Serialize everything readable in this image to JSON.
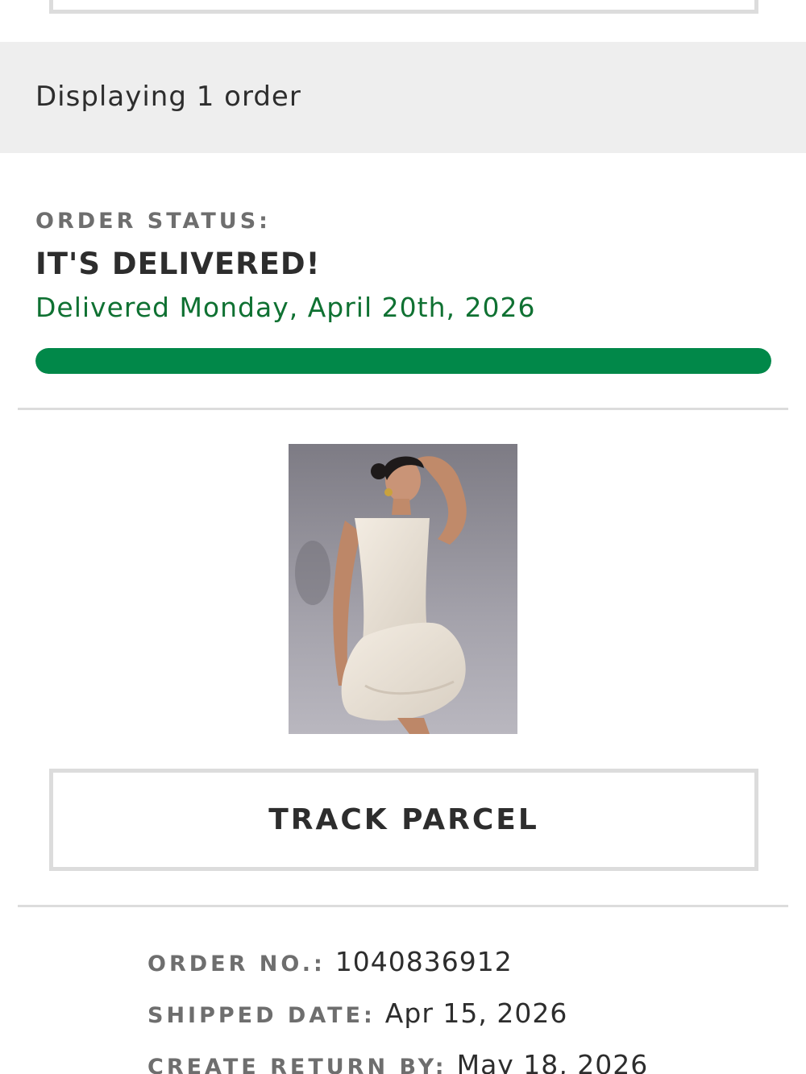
{
  "orders_summary": {
    "count_text": "Displaying 1 order"
  },
  "order": {
    "status_label": "ORDER STATUS:",
    "status_title": "IT'S DELIVERED!",
    "status_detail": "Delivered Monday, April 20th, 2026",
    "progress_percent": 100,
    "progress_color": "#018849",
    "status_color": "#0f7132",
    "product_image": "product-image-white-halter-bubble-mini-dress",
    "track_button_label": "TRACK PARCEL",
    "details": [
      {
        "label": "ORDER NO.:",
        "value": "1040836912"
      },
      {
        "label": "SHIPPED DATE:",
        "value": "Apr 15, 2026"
      },
      {
        "label": "CREATE RETURN BY:",
        "value": "May 18, 2026"
      }
    ]
  }
}
